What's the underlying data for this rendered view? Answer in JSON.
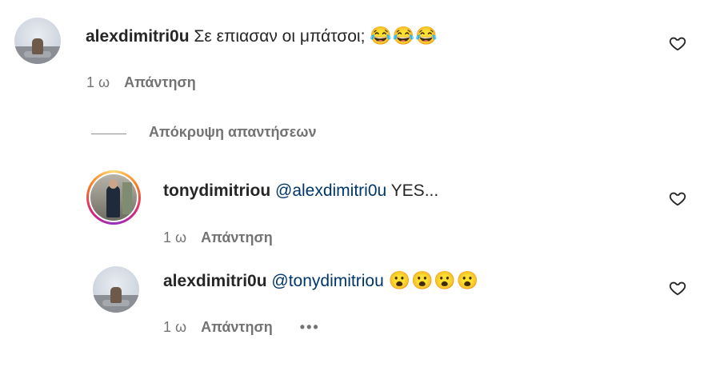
{
  "comments": [
    {
      "username": "alexdimitri0u",
      "mention": "",
      "text": "Σε επιασαν οι μπάτσοι;",
      "emoji": "😂😂😂",
      "time": "1 ω",
      "reply_label": "Απάντηση"
    },
    {
      "username": "tonydimitriou",
      "mention": "@alexdimitri0u",
      "text": "YES...",
      "emoji": "",
      "time": "1 ω",
      "reply_label": "Απάντηση"
    },
    {
      "username": "alexdimitri0u",
      "mention": "@tonydimitriou",
      "text": "",
      "emoji": "😮😮😮😮",
      "time": "1 ω",
      "reply_label": "Απάντηση",
      "more_label": "•••"
    }
  ],
  "hide_replies_label": "Απόκρυψη απαντήσεων",
  "icons": {
    "like": "heart-outline-icon",
    "more": "more-options-icon"
  }
}
